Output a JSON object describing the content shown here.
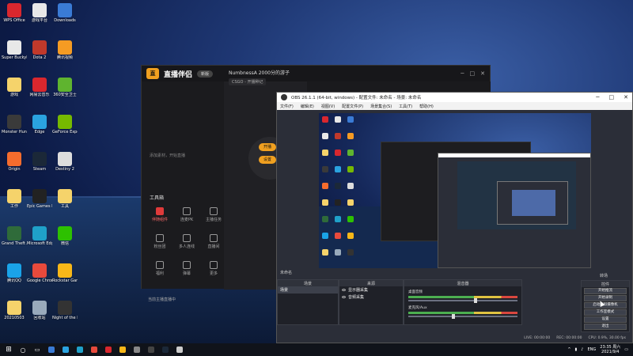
{
  "desktop_icons": [
    {
      "label": "WPS Office",
      "color": "#d9272e"
    },
    {
      "label": "Super Buckyball ...",
      "color": "#e8e8e8"
    },
    {
      "label": "游戏",
      "color": "#f5d36b"
    },
    {
      "label": "Monster Hunter...",
      "color": "#3a3a3a"
    },
    {
      "label": "Origin",
      "color": "#f56c2d"
    },
    {
      "label": "工作",
      "color": "#f5d36b"
    },
    {
      "label": "Grand Theft Auto V",
      "color": "#2f6b3a"
    },
    {
      "label": "腾讯QQ",
      "color": "#1aa3e8"
    },
    {
      "label": "20210503",
      "color": "#f5d36b"
    },
    {
      "label": "游戏平台",
      "color": "#e8e8e8"
    },
    {
      "label": "Dota 2",
      "color": "#c0392b"
    },
    {
      "label": "网易云音乐",
      "color": "#d9272e"
    },
    {
      "label": "Edge",
      "color": "#2aa3e0"
    },
    {
      "label": "Steam",
      "color": "#1b2838"
    },
    {
      "label": "Epic Games Launcher",
      "color": "#222"
    },
    {
      "label": "Microsoft Edge",
      "color": "#1fa1c9"
    },
    {
      "label": "Google Chrome",
      "color": "#e84a3c"
    },
    {
      "label": "回收站",
      "color": "#9ab"
    },
    {
      "label": "Downloads",
      "color": "#3a7bd5"
    },
    {
      "label": "腾讯视频",
      "color": "#f59b23"
    },
    {
      "label": "360安全卫士",
      "color": "#5fb42f"
    },
    {
      "label": "GeForce Experience",
      "color": "#76b900"
    },
    {
      "label": "Destiny 2",
      "color": "#ddd"
    },
    {
      "label": "工具",
      "color": "#f5d36b"
    },
    {
      "label": "微信",
      "color": "#2dc100"
    },
    {
      "label": "Rockstar Games Launcher",
      "color": "#f7b718"
    },
    {
      "label": "Night of the Dead",
      "color": "#333"
    }
  ],
  "zhibo_app": {
    "brand": "直播伴侣",
    "pill": "新版",
    "streamer": "NumbnessA 2000分的游子",
    "streamer_badge": "直播",
    "game_tag": "CSGO - 开播种记",
    "hint": "添加素材，开始直播",
    "tools_title": "工具箱",
    "tools": [
      {
        "label": "伴随组件",
        "active": true
      },
      {
        "label": "连麦PK",
        "active": false
      },
      {
        "label": "主播任务",
        "active": false
      },
      {
        "label": "粉丝团",
        "active": false
      },
      {
        "label": "多人连线",
        "active": false
      },
      {
        "label": "直播间",
        "active": false
      },
      {
        "label": "福利",
        "active": false
      },
      {
        "label": "弹幕",
        "active": false
      },
      {
        "label": "更多",
        "active": false
      }
    ],
    "btn_start": "开播",
    "btn_settings": "设置",
    "notice": "当前主播直播中"
  },
  "obs": {
    "title": "OBS 26.1.1 (64-bit, windows) - 配置文件: 未命名 - 场景: 未命名",
    "menu": [
      "文件(F)",
      "编辑(E)",
      "视图(V)",
      "配置文件(P)",
      "场景集合(S)",
      "工具(T)",
      "帮助(H)"
    ],
    "transitions_label": "转场",
    "scenes_dock": {
      "title": "场景",
      "items": [
        "场景"
      ]
    },
    "sources_dock": {
      "title": "来源",
      "items": [
        "显示器采集",
        "音频采集"
      ]
    },
    "mixer_dock": {
      "title": "混音器",
      "rows": [
        {
          "name": "桌面音频",
          "level": 0.6
        },
        {
          "name": "麦克风/Aux",
          "level": 0.4
        }
      ]
    },
    "preview_label": "未命名",
    "controls_dock": {
      "title": "控件",
      "buttons": [
        "开始推流",
        "开始录制",
        "启动虚拟摄像机",
        "工作室模式",
        "设置",
        "退出"
      ]
    },
    "status": [
      "LIVE: 00:00:00",
      "REC: 00:00:00",
      "CPU: 0.9%, 30.00 fps"
    ]
  },
  "taskbar": {
    "lang": "ENG",
    "time": "23:35 周六",
    "date": "2021/9/4",
    "app_colors": [
      "#3a7bd5",
      "#2aa3e0",
      "#1fa1c9",
      "#e84a3c",
      "#d9272e",
      "#f7b718",
      "#888",
      "#444",
      "#1b2838",
      "#ccc"
    ]
  }
}
